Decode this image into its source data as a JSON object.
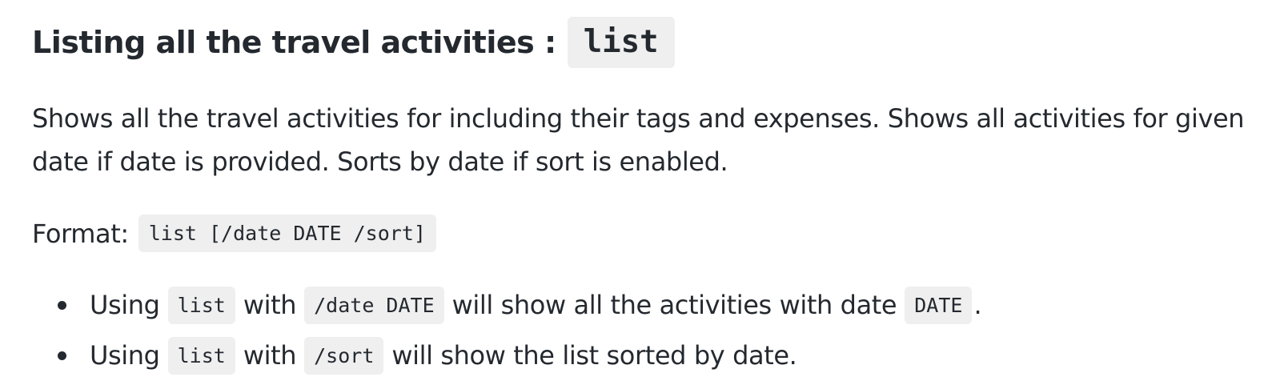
{
  "heading": {
    "text": "Listing all the travel activities :",
    "code": "list"
  },
  "description": "Shows all the travel activities for including their tags and expenses. Shows all activities for given date if date is provided. Sorts by date if sort is enabled.",
  "format": {
    "label": "Format:",
    "code": "list [/date DATE /sort]"
  },
  "bullets": [
    {
      "parts": [
        "Using",
        "list",
        "with",
        "/date DATE",
        "will show all the activities with date",
        "DATE",
        "."
      ]
    },
    {
      "parts": [
        "Using",
        "list",
        "with",
        "/sort",
        "will show the list sorted by date."
      ]
    }
  ]
}
